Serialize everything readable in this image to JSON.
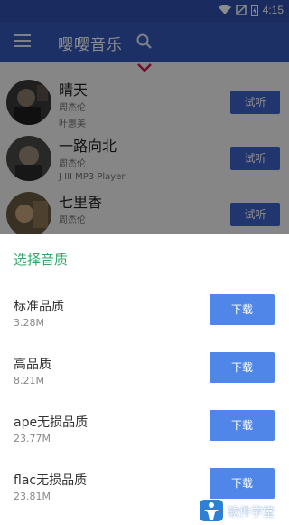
{
  "status_bar": {
    "time": "4:15",
    "icons": [
      "wifi-icon",
      "signal-icon",
      "battery-charging-icon"
    ]
  },
  "app_bar": {
    "title": "嘤嘤音乐",
    "menu_icon": "menu-icon",
    "search_icon": "search-icon"
  },
  "songs": [
    {
      "title": "晴天",
      "line1": "周杰伦",
      "line2": "叶惠美",
      "button": "试听"
    },
    {
      "title": "一路向北",
      "line1": "周杰伦",
      "line2": "J III MP3 Player",
      "button": "试听"
    },
    {
      "title": "七里香",
      "line1": "周杰伦",
      "line2": "",
      "button": "试听"
    }
  ],
  "sheet": {
    "title": "选择音质",
    "options": [
      {
        "name": "标准品质",
        "size": "3.28M",
        "button": "下载"
      },
      {
        "name": "高品质",
        "size": "8.21M",
        "button": "下载"
      },
      {
        "name": "ape无损品质",
        "size": "23.77M",
        "button": "下载"
      },
      {
        "name": "flac无损品质",
        "size": "23.81M",
        "button": "下载"
      }
    ]
  },
  "watermark": {
    "text": "软件学堂"
  },
  "colors": {
    "primary": "#3558b8",
    "accent_green": "#33a86a",
    "download_button": "#4f86e8",
    "try_button": "#3d63c9"
  }
}
